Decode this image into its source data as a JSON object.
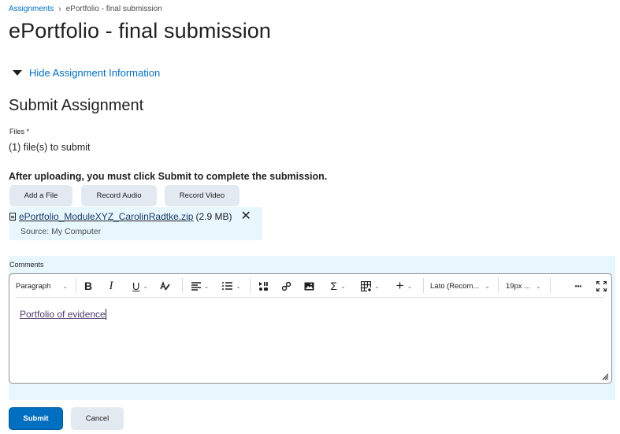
{
  "breadcrumb": {
    "parent": "Assignments",
    "separator": "›",
    "current": "ePortfolio - final submission"
  },
  "page_title": "ePortfolio - final submission",
  "assignment_info_toggle": "Hide Assignment Information",
  "submit_section": {
    "title": "Submit Assignment",
    "files_label": "Files",
    "required_marker": "*",
    "files_count": "(1) file(s) to submit",
    "note": "After uploading, you must click Submit to complete the submission.",
    "buttons": {
      "add_file": "Add a File",
      "record_audio": "Record Audio",
      "record_video": "Record Video"
    },
    "file": {
      "name": "ePortfolio_ModuleXYZ_CarolinRadtke.zip",
      "size": "(2.9 MB)",
      "source": "Source: My Computer",
      "remove_glyph": "✕"
    }
  },
  "comments": {
    "label": "Comments",
    "toolbar": {
      "block_format": "Paragraph",
      "bold": "B",
      "italic": "I",
      "underline": "U",
      "font_family": "Lato (Recom...",
      "font_size": "19px ...",
      "more": "•••",
      "sum": "Σ",
      "insert": "+"
    },
    "content": "Portfolio of evidence"
  },
  "actions": {
    "submit": "Submit",
    "cancel": "Cancel"
  },
  "colors": {
    "link": "#006fbf",
    "primary": "#006fbf",
    "secondary_button": "#e3e9f1",
    "highlight_band": "#e8f6fe"
  }
}
